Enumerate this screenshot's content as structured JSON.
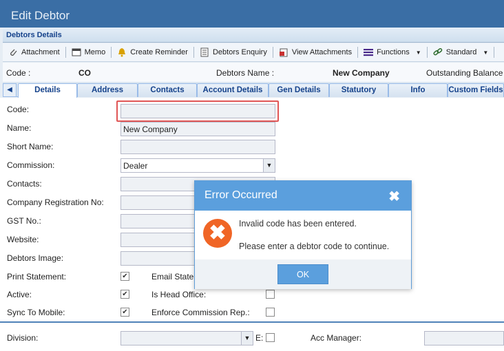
{
  "window": {
    "title": "Edit Debtor"
  },
  "panel": {
    "title": "Debtors Details"
  },
  "toolbar": {
    "attachment": "Attachment",
    "memo": "Memo",
    "create_reminder": "Create Reminder",
    "debtors_enquiry": "Debtors Enquiry",
    "view_attachments": "View Attachments",
    "functions": "Functions",
    "standard": "Standard"
  },
  "summary": {
    "code_label": "Code :",
    "code_value": "CO",
    "name_label": "Debtors Name :",
    "name_value": "New Company",
    "balance_label": "Outstanding Balance :"
  },
  "tabs": [
    "Details",
    "Address",
    "Contacts",
    "Account Details",
    "Gen Details",
    "Statutory",
    "Info",
    "Custom Fields"
  ],
  "form": {
    "code_label": "Code:",
    "code_value": "",
    "name_label": "Name:",
    "name_value": "New Company",
    "short_name_label": "Short Name:",
    "commission_label": "Commission:",
    "commission_value": "Dealer",
    "contacts_label": "Contacts:",
    "company_reg_label": "Company Registration No:",
    "gst_label": "GST No.:",
    "website_label": "Website:",
    "debtors_image_label": "Debtors Image:",
    "print_statement_label": "Print Statement:",
    "email_statement_label": "Email State",
    "active_label": "Active:",
    "is_head_office_label": "Is Head Office:",
    "sync_mobile_label": "Sync To Mobile:",
    "enforce_commission_label": "Enforce Commission Rep.:",
    "division_label": "Division:",
    "e_label": "E:",
    "acc_manager_label": "Acc Manager:",
    "check_mark": "✔"
  },
  "dialog": {
    "title": "Error Occurred",
    "close": "✖",
    "icon": "✖",
    "line1": "Invalid code has been entered.",
    "line2": "Please enter a debtor code to continue.",
    "ok": "OK"
  }
}
